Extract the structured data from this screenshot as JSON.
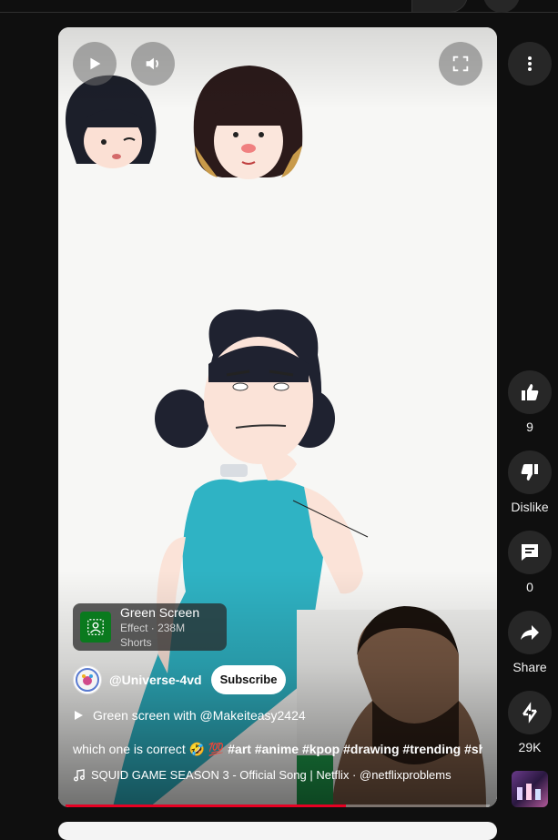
{
  "player": {
    "effect": {
      "title": "Green Screen",
      "subtitle": "Effect · 238M Shorts"
    },
    "channel": {
      "handle": "@Universe-4vd",
      "subscribe_label": "Subscribe"
    },
    "linked_video": "Green screen with @Makeiteasy2424",
    "description": {
      "text": "which one is correct 🤣 💯 ",
      "hashtags": "#art #anime #kpop #drawing #trending #sh"
    },
    "music": "SQUID GAME SEASON 3 - Official Song | Netflix · @netflixproblems",
    "progress": 0.66
  },
  "actions": {
    "like_count": "9",
    "dislike_label": "Dislike",
    "comment_count": "0",
    "share_label": "Share",
    "remix_count": "29K"
  },
  "icons": [
    "play-icon",
    "volume-icon",
    "fullscreen-icon",
    "more-vert-icon",
    "thumb-up-icon",
    "thumb-down-icon",
    "comment-icon",
    "share-icon",
    "remix-icon",
    "music-note-icon",
    "green-screen-icon"
  ],
  "colors": {
    "page_bg": "#0f0f0f",
    "button_bg": "#272727",
    "progress": "#e60023",
    "effect_thumb": "#0a7a1e"
  }
}
